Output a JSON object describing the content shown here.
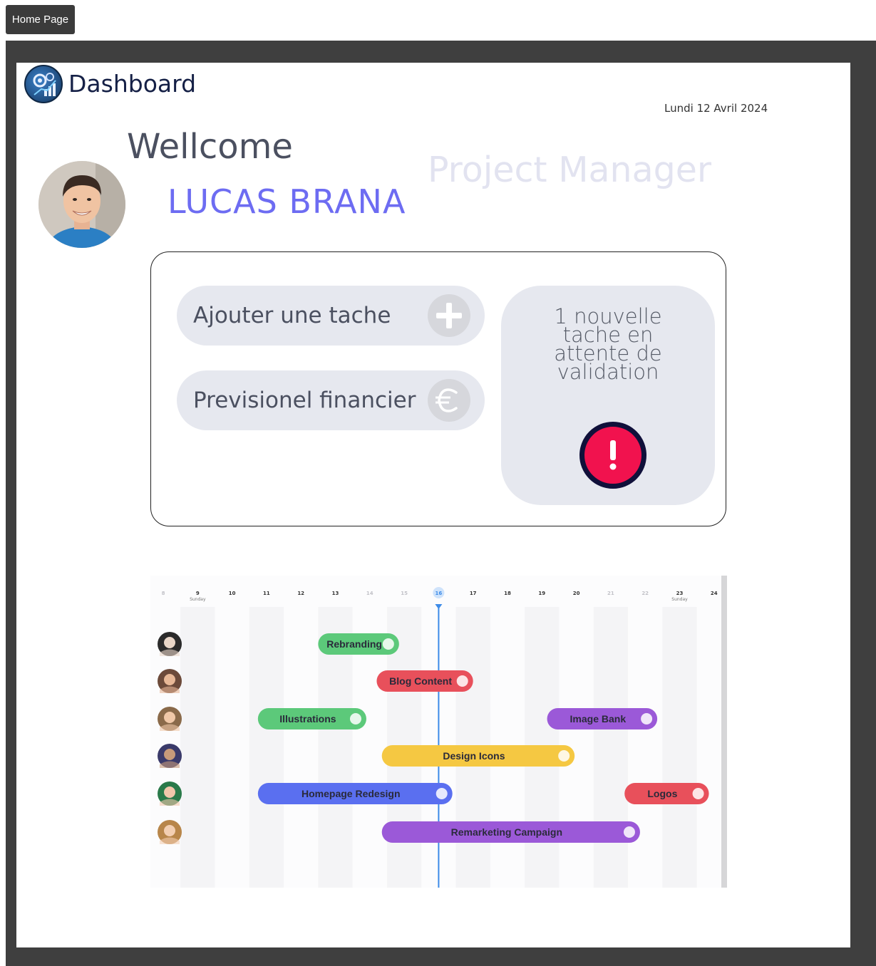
{
  "nav": {
    "home_label": "Home Page"
  },
  "header": {
    "title": "Dashboard",
    "date": "Lundi 12 Avril 2024"
  },
  "welcome": {
    "greeting": "Wellcome",
    "name": "LUCAS BRANA",
    "role": "Project Manager"
  },
  "actions": {
    "add_task_label": "Ajouter une tache",
    "forecast_label": "Previsionel financier"
  },
  "notification": {
    "lines": [
      "1 nouvelle",
      "tache en",
      "attente de",
      "validation"
    ]
  },
  "gantt": {
    "days": [
      {
        "num": "8",
        "sub": "",
        "muted": true
      },
      {
        "num": "9",
        "sub": "Sunday",
        "muted": false
      },
      {
        "num": "10",
        "sub": "",
        "muted": false
      },
      {
        "num": "11",
        "sub": "",
        "muted": false
      },
      {
        "num": "12",
        "sub": "",
        "muted": false
      },
      {
        "num": "13",
        "sub": "",
        "muted": false
      },
      {
        "num": "14",
        "sub": "",
        "muted": true
      },
      {
        "num": "15",
        "sub": "",
        "muted": true
      },
      {
        "num": "16",
        "sub": "",
        "muted": false,
        "today": true
      },
      {
        "num": "17",
        "sub": "",
        "muted": false
      },
      {
        "num": "18",
        "sub": "",
        "muted": false
      },
      {
        "num": "19",
        "sub": "",
        "muted": false
      },
      {
        "num": "20",
        "sub": "",
        "muted": false
      },
      {
        "num": "21",
        "sub": "",
        "muted": true
      },
      {
        "num": "22",
        "sub": "",
        "muted": true
      },
      {
        "num": "23",
        "sub": "Sunday",
        "muted": false
      },
      {
        "num": "24",
        "sub": "",
        "muted": false
      }
    ],
    "tasks": [
      {
        "row": 0,
        "label": "Rebranding",
        "start": 12.5,
        "end": 14.85,
        "color": "#5cc97a"
      },
      {
        "row": 1,
        "label": "Blog Content",
        "start": 14.2,
        "end": 17.0,
        "color": "#e8505b"
      },
      {
        "row": 2,
        "label": "Illustrations",
        "start": 10.75,
        "end": 13.9,
        "color": "#5cc97a"
      },
      {
        "row": 2,
        "label": "Image Bank",
        "start": 19.15,
        "end": 22.35,
        "color": "#9b59d8"
      },
      {
        "row": 3,
        "label": "Design Icons",
        "start": 14.35,
        "end": 19.95,
        "color": "#f5c842"
      },
      {
        "row": 4,
        "label": "Homepage Redesign",
        "start": 10.75,
        "end": 16.4,
        "color": "#5a6ff0"
      },
      {
        "row": 4,
        "label": "Logos",
        "start": 21.4,
        "end": 23.85,
        "color": "#e8505b"
      },
      {
        "row": 5,
        "label": "Remarketing Campaign",
        "start": 14.35,
        "end": 21.85,
        "color": "#9b59d8"
      }
    ],
    "today": 16
  }
}
